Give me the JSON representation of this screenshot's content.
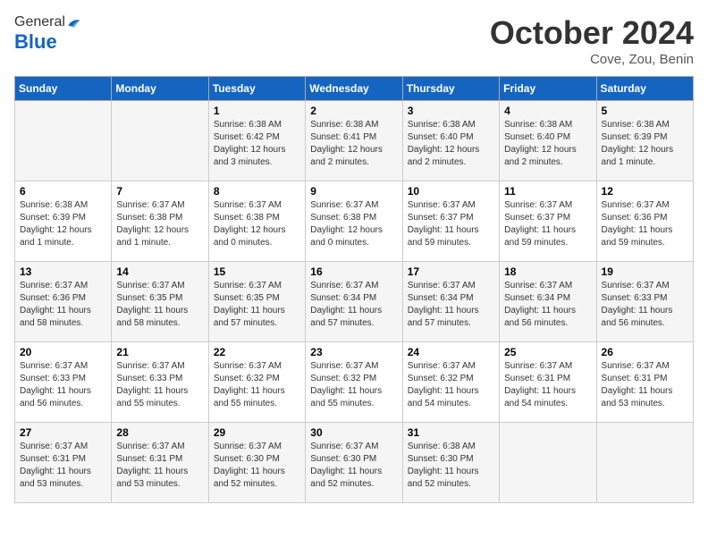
{
  "header": {
    "logo_general": "General",
    "logo_blue": "Blue",
    "month_title": "October 2024",
    "subtitle": "Cove, Zou, Benin"
  },
  "days_of_week": [
    "Sunday",
    "Monday",
    "Tuesday",
    "Wednesday",
    "Thursday",
    "Friday",
    "Saturday"
  ],
  "weeks": [
    [
      {
        "day": "",
        "info": ""
      },
      {
        "day": "",
        "info": ""
      },
      {
        "day": "1",
        "info": "Sunrise: 6:38 AM\nSunset: 6:42 PM\nDaylight: 12 hours\nand 3 minutes."
      },
      {
        "day": "2",
        "info": "Sunrise: 6:38 AM\nSunset: 6:41 PM\nDaylight: 12 hours\nand 2 minutes."
      },
      {
        "day": "3",
        "info": "Sunrise: 6:38 AM\nSunset: 6:40 PM\nDaylight: 12 hours\nand 2 minutes."
      },
      {
        "day": "4",
        "info": "Sunrise: 6:38 AM\nSunset: 6:40 PM\nDaylight: 12 hours\nand 2 minutes."
      },
      {
        "day": "5",
        "info": "Sunrise: 6:38 AM\nSunset: 6:39 PM\nDaylight: 12 hours\nand 1 minute."
      }
    ],
    [
      {
        "day": "6",
        "info": "Sunrise: 6:38 AM\nSunset: 6:39 PM\nDaylight: 12 hours\nand 1 minute."
      },
      {
        "day": "7",
        "info": "Sunrise: 6:37 AM\nSunset: 6:38 PM\nDaylight: 12 hours\nand 1 minute."
      },
      {
        "day": "8",
        "info": "Sunrise: 6:37 AM\nSunset: 6:38 PM\nDaylight: 12 hours\nand 0 minutes."
      },
      {
        "day": "9",
        "info": "Sunrise: 6:37 AM\nSunset: 6:38 PM\nDaylight: 12 hours\nand 0 minutes."
      },
      {
        "day": "10",
        "info": "Sunrise: 6:37 AM\nSunset: 6:37 PM\nDaylight: 11 hours\nand 59 minutes."
      },
      {
        "day": "11",
        "info": "Sunrise: 6:37 AM\nSunset: 6:37 PM\nDaylight: 11 hours\nand 59 minutes."
      },
      {
        "day": "12",
        "info": "Sunrise: 6:37 AM\nSunset: 6:36 PM\nDaylight: 11 hours\nand 59 minutes."
      }
    ],
    [
      {
        "day": "13",
        "info": "Sunrise: 6:37 AM\nSunset: 6:36 PM\nDaylight: 11 hours\nand 58 minutes."
      },
      {
        "day": "14",
        "info": "Sunrise: 6:37 AM\nSunset: 6:35 PM\nDaylight: 11 hours\nand 58 minutes."
      },
      {
        "day": "15",
        "info": "Sunrise: 6:37 AM\nSunset: 6:35 PM\nDaylight: 11 hours\nand 57 minutes."
      },
      {
        "day": "16",
        "info": "Sunrise: 6:37 AM\nSunset: 6:34 PM\nDaylight: 11 hours\nand 57 minutes."
      },
      {
        "day": "17",
        "info": "Sunrise: 6:37 AM\nSunset: 6:34 PM\nDaylight: 11 hours\nand 57 minutes."
      },
      {
        "day": "18",
        "info": "Sunrise: 6:37 AM\nSunset: 6:34 PM\nDaylight: 11 hours\nand 56 minutes."
      },
      {
        "day": "19",
        "info": "Sunrise: 6:37 AM\nSunset: 6:33 PM\nDaylight: 11 hours\nand 56 minutes."
      }
    ],
    [
      {
        "day": "20",
        "info": "Sunrise: 6:37 AM\nSunset: 6:33 PM\nDaylight: 11 hours\nand 56 minutes."
      },
      {
        "day": "21",
        "info": "Sunrise: 6:37 AM\nSunset: 6:33 PM\nDaylight: 11 hours\nand 55 minutes."
      },
      {
        "day": "22",
        "info": "Sunrise: 6:37 AM\nSunset: 6:32 PM\nDaylight: 11 hours\nand 55 minutes."
      },
      {
        "day": "23",
        "info": "Sunrise: 6:37 AM\nSunset: 6:32 PM\nDaylight: 11 hours\nand 55 minutes."
      },
      {
        "day": "24",
        "info": "Sunrise: 6:37 AM\nSunset: 6:32 PM\nDaylight: 11 hours\nand 54 minutes."
      },
      {
        "day": "25",
        "info": "Sunrise: 6:37 AM\nSunset: 6:31 PM\nDaylight: 11 hours\nand 54 minutes."
      },
      {
        "day": "26",
        "info": "Sunrise: 6:37 AM\nSunset: 6:31 PM\nDaylight: 11 hours\nand 53 minutes."
      }
    ],
    [
      {
        "day": "27",
        "info": "Sunrise: 6:37 AM\nSunset: 6:31 PM\nDaylight: 11 hours\nand 53 minutes."
      },
      {
        "day": "28",
        "info": "Sunrise: 6:37 AM\nSunset: 6:31 PM\nDaylight: 11 hours\nand 53 minutes."
      },
      {
        "day": "29",
        "info": "Sunrise: 6:37 AM\nSunset: 6:30 PM\nDaylight: 11 hours\nand 52 minutes."
      },
      {
        "day": "30",
        "info": "Sunrise: 6:37 AM\nSunset: 6:30 PM\nDaylight: 11 hours\nand 52 minutes."
      },
      {
        "day": "31",
        "info": "Sunrise: 6:38 AM\nSunset: 6:30 PM\nDaylight: 11 hours\nand 52 minutes."
      },
      {
        "day": "",
        "info": ""
      },
      {
        "day": "",
        "info": ""
      }
    ]
  ]
}
